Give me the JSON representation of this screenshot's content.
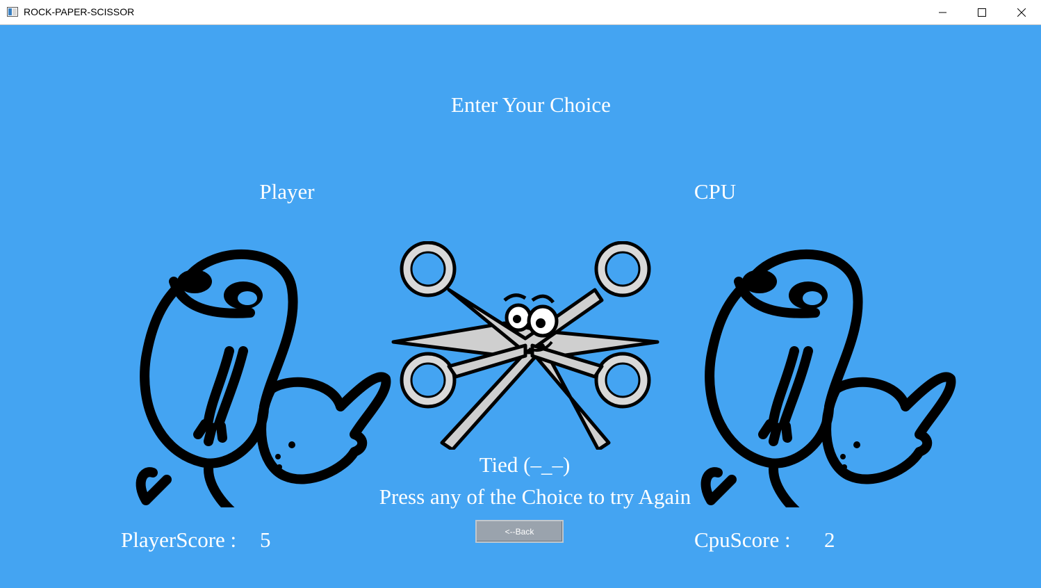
{
  "window": {
    "title": "ROCK-PAPER-SCISSOR",
    "icons": {
      "app": "app-window-icon",
      "minimize": "minimize-icon",
      "maximize": "maximize-icon",
      "close": "close-icon"
    }
  },
  "game": {
    "heading": "Enter Your Choice",
    "player_label": "Player",
    "cpu_label": "CPU",
    "player_choice_icon": "paper-hand-icon",
    "center_icon": "scissors-icon",
    "cpu_choice_icon": "paper-hand-icon",
    "result_text": "Tied (–_–)",
    "prompt_text": "Press any of the Choice to try Again",
    "back_label": "<--Back",
    "player_score_label": "PlayerScore :",
    "player_score": "5",
    "cpu_score_label": "CpuScore :",
    "cpu_score": "2"
  },
  "colors": {
    "background": "#44a4f2",
    "text": "#ffffff",
    "button": "#9aa3ad"
  }
}
